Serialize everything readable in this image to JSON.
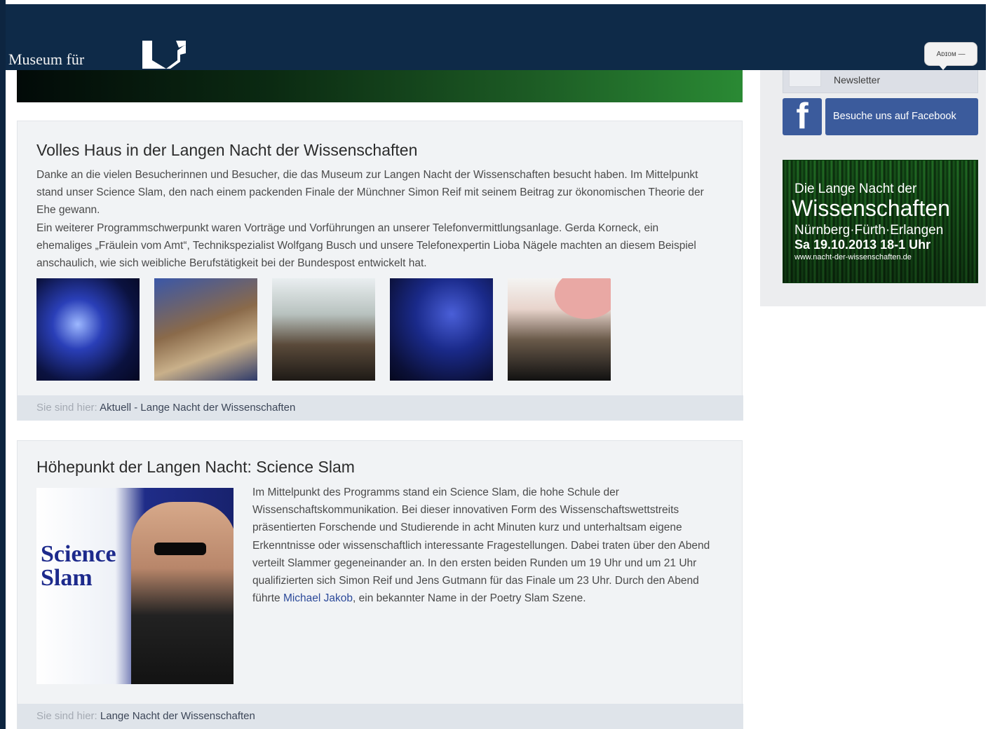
{
  "header": {
    "brand_text": "Museum für",
    "language_button_label": "Aᴅɪᴏᴍ —"
  },
  "sidebar": {
    "newsletter_label": "Newsletter",
    "facebook_label": "Besuche uns auf Facebook",
    "banner": {
      "line1": "Die Lange Nacht der",
      "line2": "Wissenschaften",
      "line3": "Nürnberg·Fürth·Erlangen",
      "line4": "Sa 19.10.2013   18-1 Uhr",
      "line5": "www.nacht-der-wissenschaften.de"
    }
  },
  "article1": {
    "title": "Volles Haus in der Langen Nacht der Wissenschaften",
    "paragraph1": "Danke an die vielen Besucherinnen und Besucher, die das Museum zur Langen Nacht der Wissenschaften besucht haben. Im Mittelpunkt stand unser Science Slam, den nach einem packenden Finale der Münchner Simon Reif mit seinem Beitrag zur ökonomischen Theorie der Ehe gewann.",
    "paragraph2": "Ein weiterer Programmschwerpunkt waren Vorträge und Vorführungen an unserer Telefonvermittlungsanlage. Gerda Korneck, ein ehemaliges „Fräulein vom Amt“, Technikspezialist Wolfgang Busch und unsere Telefonexpertin Lioba Nägele machten an diesem Beispiel anschaulich, wie sich weibliche Berufstätigkeit bei der Bundespost entwickelt hat.",
    "breadcrumb_label": "Sie sind hier:",
    "breadcrumb_path": "Aktuell - Lange Nacht der Wissenschaften"
  },
  "article2": {
    "title": "Höhepunkt der Langen Nacht: Science Slam",
    "image_word1": "Science",
    "image_word2": "Slam",
    "text_before_link": "Im Mittelpunkt des Programms stand ein Science Slam, die hohe Schule der Wissenschaftskommunikation. Bei dieser innovativen Form des Wissenschaftswettstreits präsentierten Forschende und Studierende in acht Minuten kurz und unterhaltsam eigene Erkenntnisse oder wissenschaftlich interessante Fragestellungen. Dabei traten über den Abend verteilt Slammer gegeneinander an. In den ersten beiden Runden um 19 Uhr und um 21 Uhr qualifizierten sich Simon Reif und Jens Gutmann für das Finale um 23 Uhr. Durch den Abend führte ",
    "link_text": "Michael Jakob",
    "text_after_link": ", ein bekannter Name in der Poetry Slam Szene.",
    "breadcrumb_label": "Sie sind hier:",
    "breadcrumb_path": "Lange Nacht der Wissenschaften"
  },
  "colors": {
    "header_bg": "#0e2a48",
    "facebook_blue": "#3b5b9c",
    "link_blue": "#2c4a9a"
  }
}
